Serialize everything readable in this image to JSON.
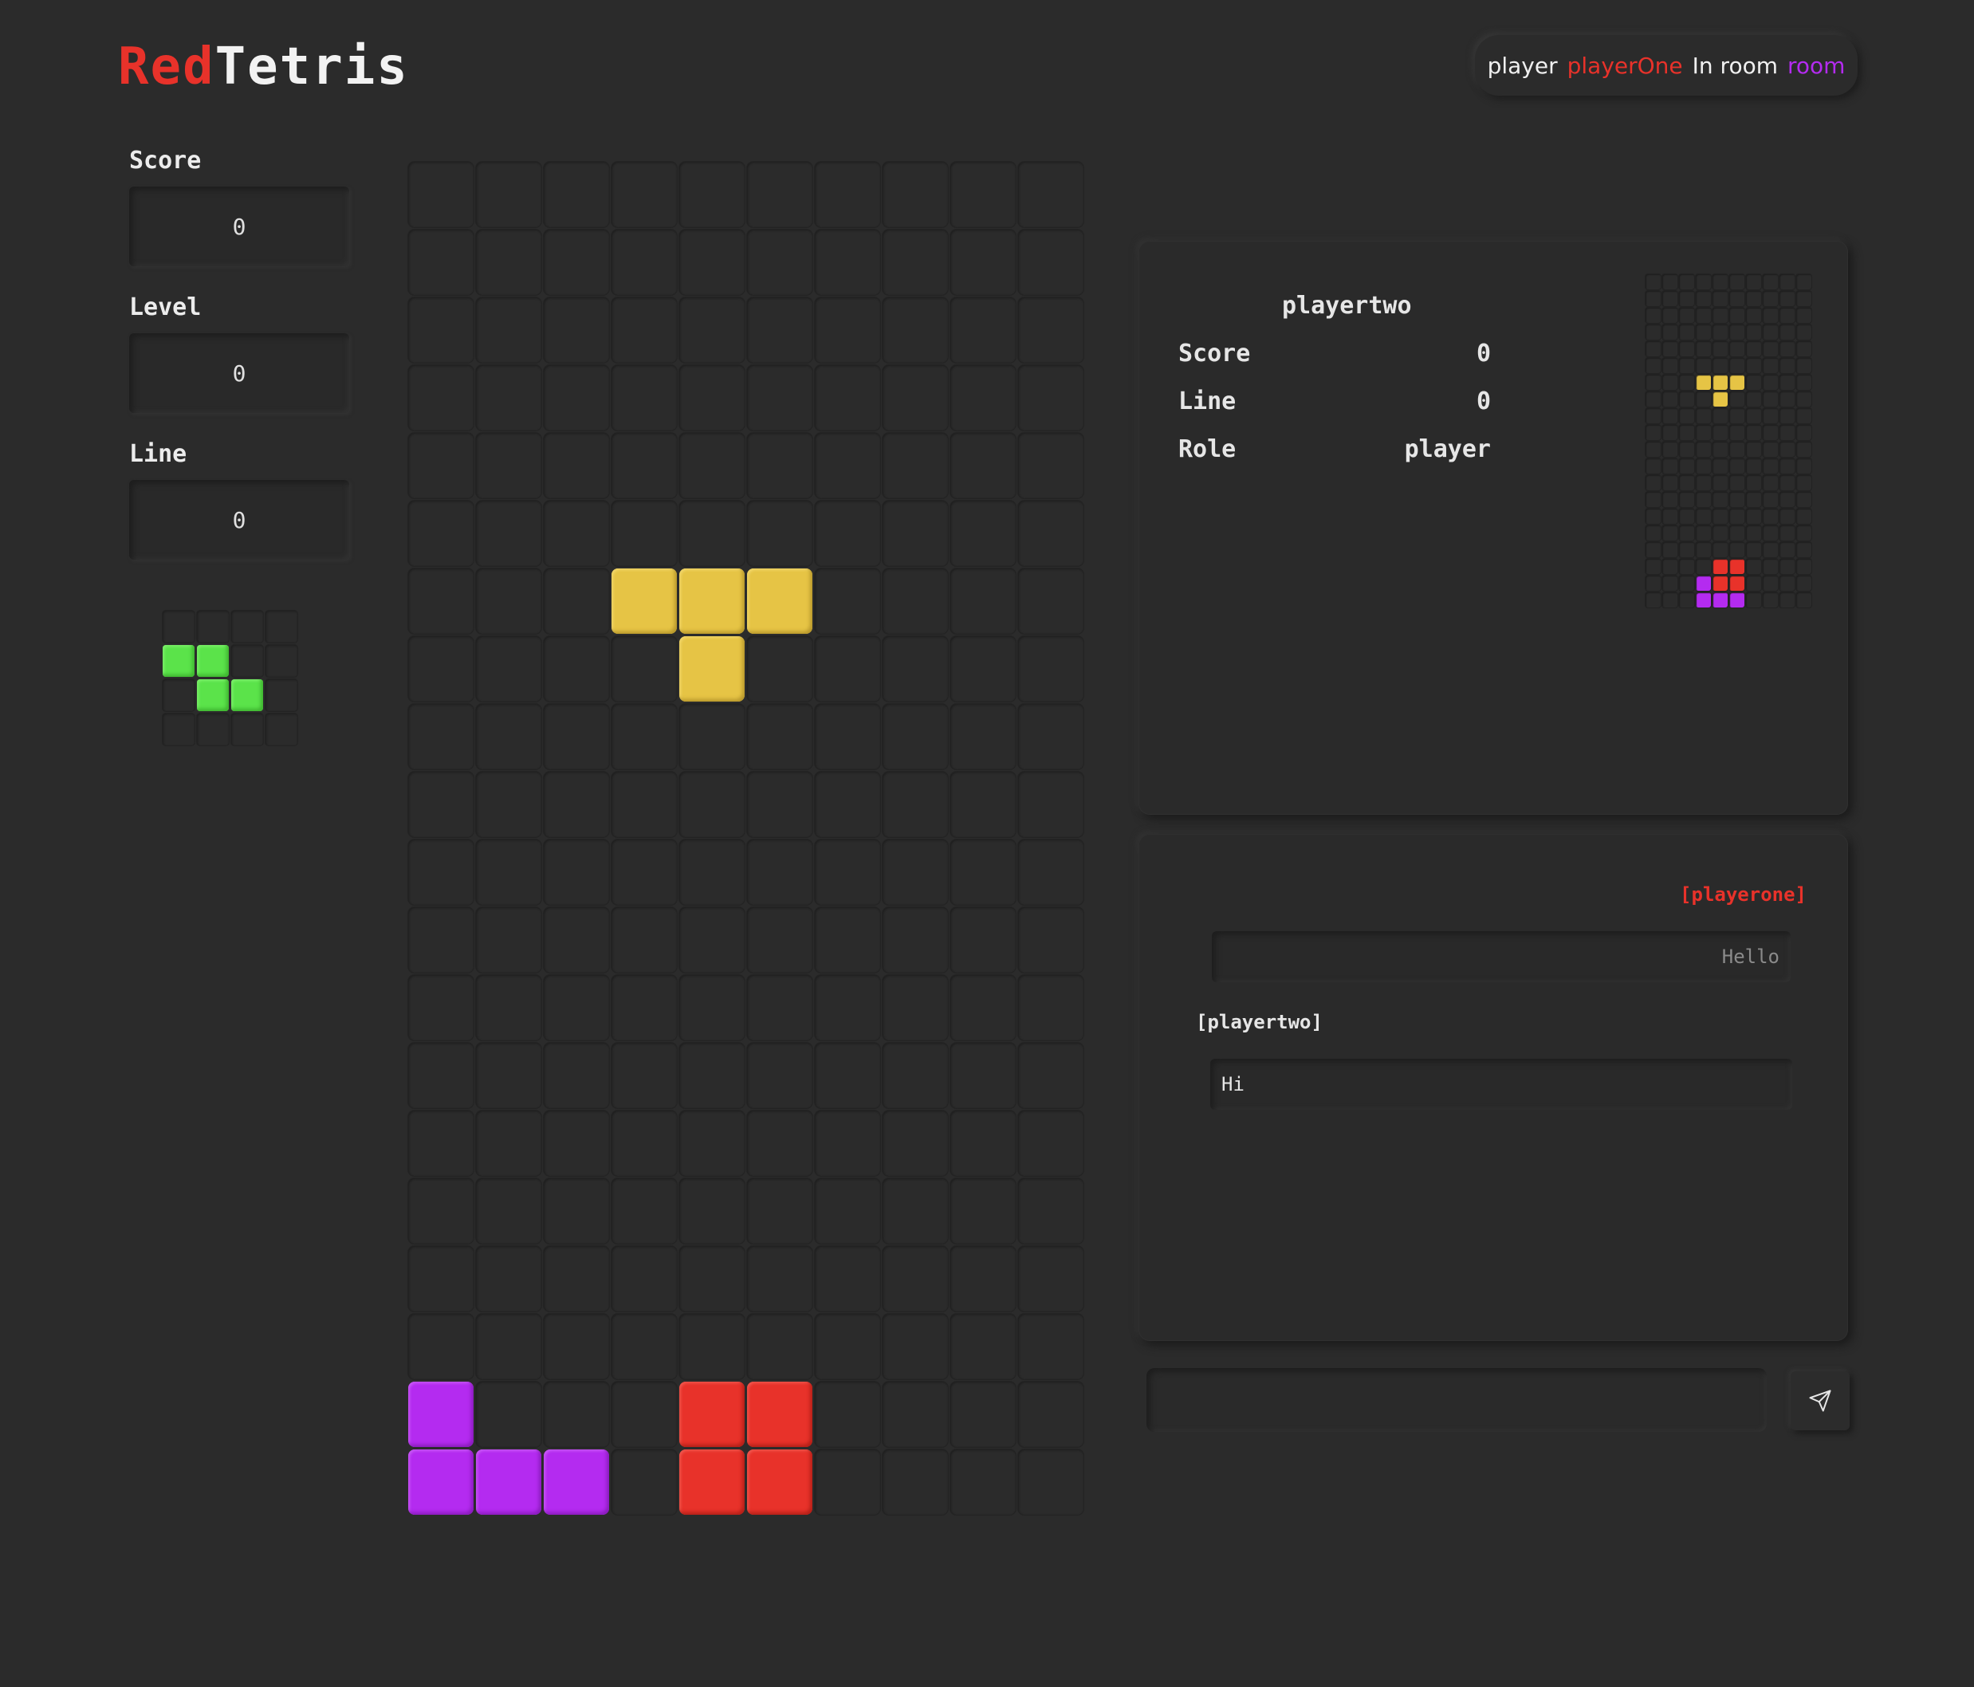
{
  "header": {
    "logo_part1": "Red",
    "logo_part2": "Tetris",
    "player_prefix": "player",
    "player_name": "playerOne",
    "room_prefix": "In room",
    "room_name": "room"
  },
  "stats": {
    "score_label": "Score",
    "score_value": "0",
    "level_label": "Level",
    "level_value": "0",
    "line_label": "Line",
    "line_value": "0"
  },
  "next_piece": [
    "....",
    "GG..",
    ".GG.",
    "...."
  ],
  "board": {
    "cols": 10,
    "rows": [
      "..........",
      "..........",
      "..........",
      "..........",
      "..........",
      "..........",
      "...YYY....",
      "....Y.....",
      "..........",
      "..........",
      "..........",
      "..........",
      "..........",
      "..........",
      "..........",
      "..........",
      "..........",
      "..........",
      "P...RR....",
      "PPP.RR...."
    ]
  },
  "opponent": {
    "name": "playertwo",
    "score_label": "Score",
    "score_value": "0",
    "line_label": "Line",
    "line_value": "0",
    "role_label": "Role",
    "role_value": "player",
    "board_rows": [
      "..........",
      "..........",
      "..........",
      "..........",
      "..........",
      "..........",
      "...YYY....",
      "....Y.....",
      "..........",
      "..........",
      "..........",
      "..........",
      "..........",
      "..........",
      "..........",
      "..........",
      "..........",
      "....RR....",
      "...PRR....",
      "...PPP...."
    ]
  },
  "chat": {
    "messages": [
      {
        "author": "[playerone]",
        "text": "Hello"
      },
      {
        "author": "[playertwo]",
        "text": "Hi"
      }
    ],
    "input_value": ""
  },
  "colors": {
    "background": "#2b2b2b",
    "accent_red": "#e8322a",
    "accent_purple": "#b42bf0",
    "Y": "#e6c445",
    "R": "#e8322a",
    "P": "#b42bf0",
    "G": "#5be34a"
  },
  "icons": {
    "send": "send-icon"
  }
}
